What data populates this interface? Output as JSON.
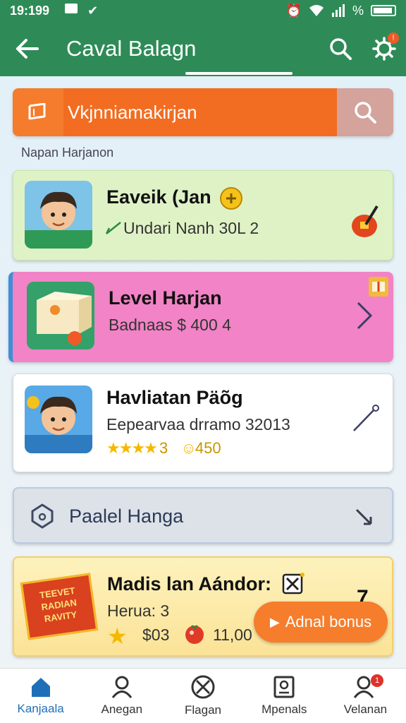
{
  "status_bar": {
    "time": "19:199",
    "battery_label": "%"
  },
  "app_bar": {
    "title": "Caval Balagn",
    "notification_count": "!"
  },
  "search": {
    "value": "Vkjnniamakirjan"
  },
  "section_label": "Napan Harjanon",
  "cards": [
    {
      "title": "Eaveik (Jan",
      "subtitle": "Undari Nanh 30L 2"
    },
    {
      "title": "Level Harjan",
      "subtitle": "Badnaas $ 400  4"
    },
    {
      "title": "Havliatan Päõg",
      "subtitle": "Eepearvaa drramo 32013",
      "stars_text": "★★★★",
      "rating_text": "3",
      "points": "450"
    },
    {
      "title": "Paalel Hanga"
    },
    {
      "title": "Madis lan Aándor:",
      "subtitle": "Herua: 3",
      "price": "$03",
      "count": "11,00",
      "badge_text": "TEEVET RADIAN RAVITY",
      "trail_number": "7",
      "bonus_label": "Adnal bonus"
    }
  ],
  "bottom_nav": [
    {
      "label": "Kanjaala",
      "active": true
    },
    {
      "label": "Anegan"
    },
    {
      "label": "Flagan"
    },
    {
      "label": "Mpenals"
    },
    {
      "label": "Velanan",
      "badge": "1"
    }
  ],
  "colors": {
    "primary": "#2e8b57",
    "accent": "#f26d21",
    "active_nav": "#1f6fb8"
  }
}
